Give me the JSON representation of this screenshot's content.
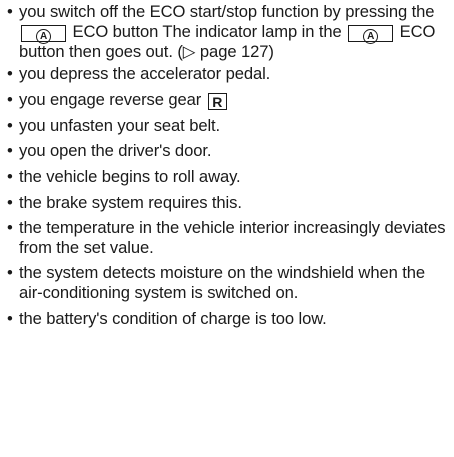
{
  "bullet": "•",
  "items": [
    {
      "segments": {
        "t1": "you switch off the ECO start/stop function by pressing the ",
        "key1": "A",
        "t2": " ECO button The indicator lamp in the ",
        "key2": "A",
        "t3": " ECO button then goes out. (▷ page 127)"
      }
    },
    {
      "text": "you depress the accelerator pedal."
    },
    {
      "segments": {
        "t1": "you engage reverse gear ",
        "key": "R"
      }
    },
    {
      "text": "you unfasten your seat belt."
    },
    {
      "text": "you open the driver's door."
    },
    {
      "text": "the vehicle begins to roll away."
    },
    {
      "text": "the brake system requires this."
    },
    {
      "text": "the temperature in the vehicle interior increasingly deviates from the set value."
    },
    {
      "text": "the system detects moisture on the wind­shield when the air-conditioning system is switched on."
    },
    {
      "text": "the battery's condition of charge is too low."
    }
  ]
}
